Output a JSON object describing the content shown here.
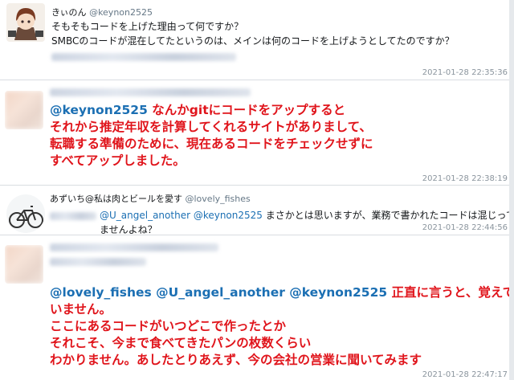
{
  "tweets": [
    {
      "display_name": "きぃのん",
      "handle": "@keynon2525",
      "lines": [
        "そもそもコードを上げた理由って何ですか？",
        "SMBCのコードが混在してたというのは、メインは何のコードを上げようとしてたのですか？"
      ],
      "timestamp": "2021-01-28 22:35:36"
    },
    {
      "mention": "@keynon2525",
      "lines": [
        "なんかgitにコードをアップすると",
        "それから推定年収を計算してくれるサイトがありまして、",
        "転職する準備のために、現在あるコードをチェックせずに",
        "すべてアップしました。"
      ],
      "timestamp": "2021-01-28 22:38:19"
    },
    {
      "display_name": "あずいち@私は肉とビールを愛す",
      "handle": "@lovely_fishes",
      "mentions": "@U_angel_another @keynon2525",
      "line1_rest": "まさかとは思いますが、業務で書かれたコードは混じって",
      "line2": "ませんよね？",
      "timestamp": "2021-01-28 22:44:56"
    },
    {
      "mentions": "@lovely_fishes @U_angel_another @keynon2525",
      "line1_rest": "正直に言うと、覚えて",
      "lines": [
        "いません。",
        "ここにあるコードがいつどこで作ったとか",
        "それこそ、今まで食べてきたパンの枚数くらい",
        "わかりません。あしたとりあえず、今の会社の営業に聞いてみます"
      ],
      "timestamp": "2021-01-28 22:47:17"
    }
  ],
  "colors": {
    "mention": "#1b6fb3",
    "emphasis": "#e0141b",
    "muted": "#8a949d"
  }
}
